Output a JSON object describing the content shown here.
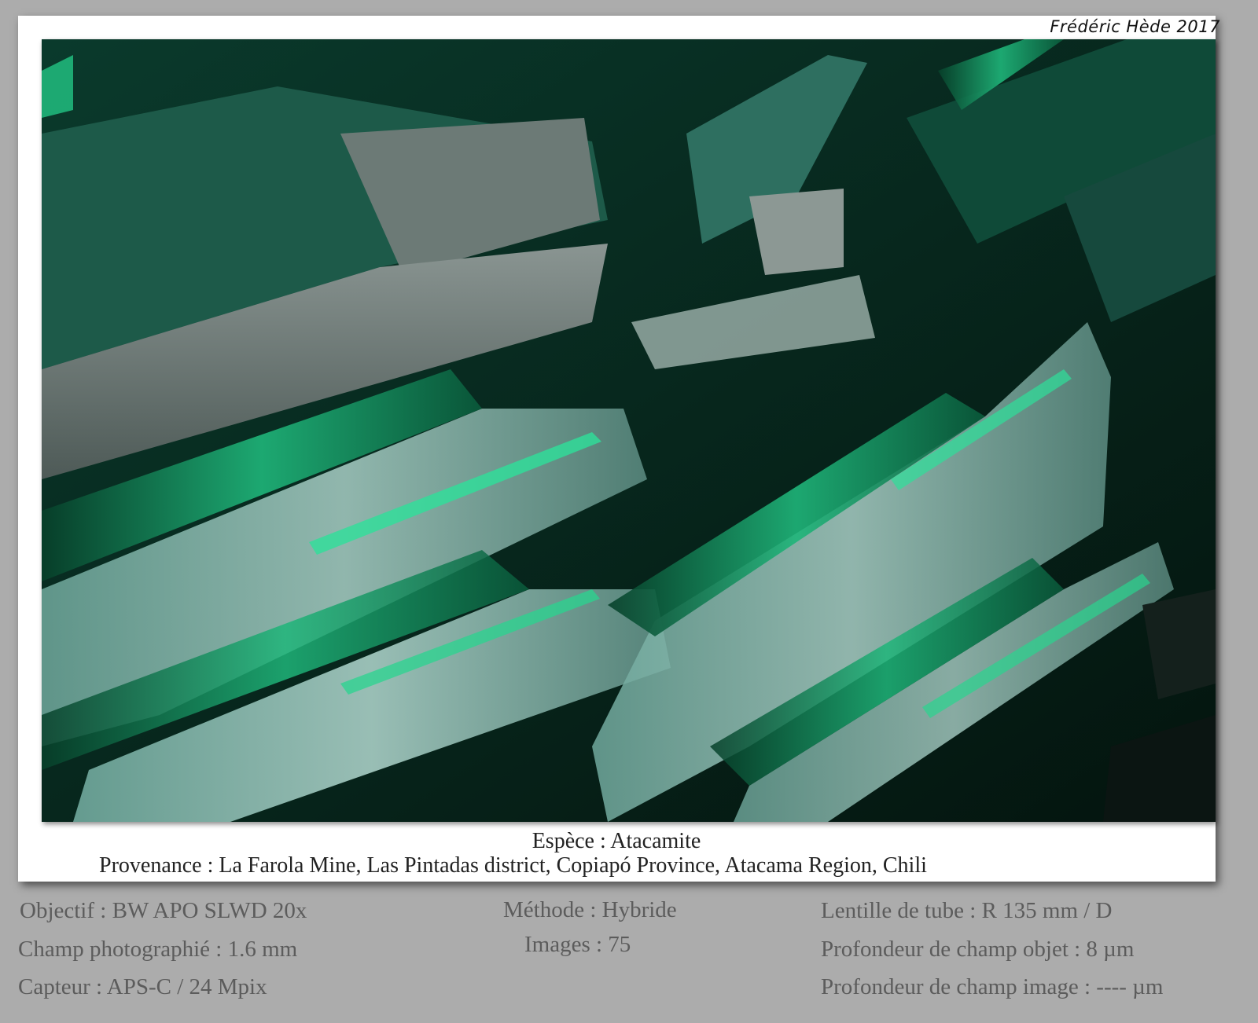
{
  "signature": "Frédéric Hède 2017",
  "caption": {
    "species": "Espèce : Atacamite",
    "provenance": "Provenance : La Farola Mine, Las Pintadas district, Copiapó Province, Atacama Region, Chili"
  },
  "details": {
    "objectif": "Objectif : BW APO SLWD 20x",
    "champ": "Champ photographié : 1.6 mm",
    "capteur": "Capteur : APS-C / 24 Mpix",
    "methode": "Méthode : Hybride",
    "images": "Images : 75",
    "lentille": "Lentille de tube : R 135 mm / D",
    "profondeur_objet": "Profondeur de champ objet : 8 µm",
    "profondeur_image": "Profondeur de champ image : ---- µm"
  },
  "colors": {
    "background": "#acacac",
    "crystal_green": "#1fb67a",
    "crystal_pale": "#a9cfc6",
    "crystal_dark": "#062018"
  }
}
